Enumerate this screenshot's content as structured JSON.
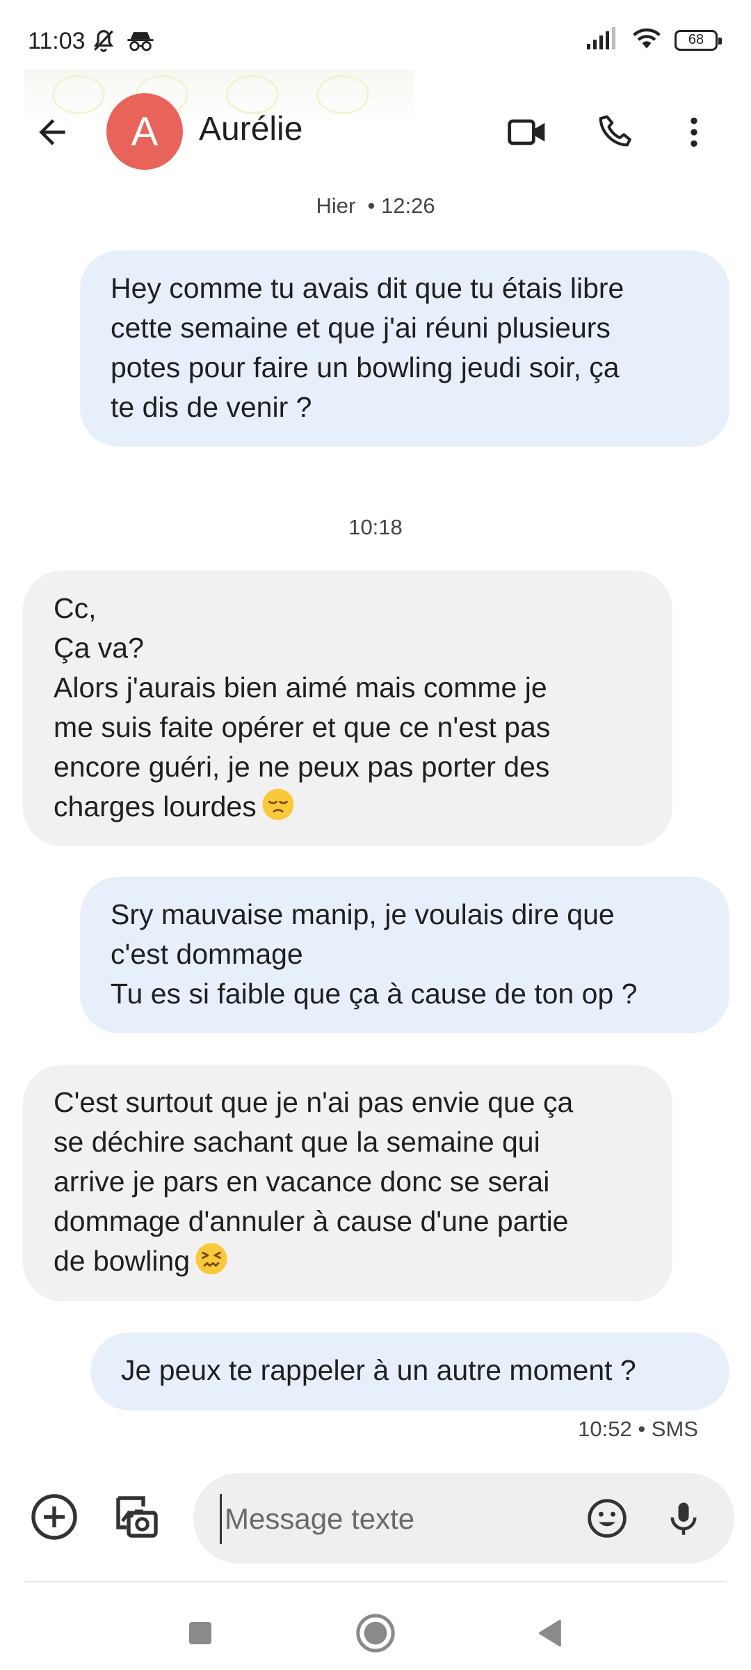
{
  "status_bar": {
    "time": "11:03",
    "battery": "68",
    "icons": [
      "mute-bell-icon",
      "incognito-icon",
      "signal-icon",
      "wifi-icon",
      "battery-icon"
    ]
  },
  "header": {
    "avatar_letter": "A",
    "avatar_color": "#e8645a",
    "contact_name": "Aurélie",
    "icons": [
      "back-arrow-icon",
      "video-call-icon",
      "phone-icon",
      "more-vert-icon"
    ]
  },
  "conversation": {
    "timestamp_1_day": "Hier",
    "timestamp_1_time": "• 12:26",
    "timestamp_2": "10:18",
    "messages": [
      {
        "direction": "outgoing",
        "lines": [
          "Hey comme tu avais dit que tu étais libre",
          "cette semaine et que j'ai réuni plusieurs",
          "potes pour faire un bowling jeudi soir, ça",
          "te dis de venir ?"
        ]
      },
      {
        "direction": "incoming",
        "lines": [
          "Cc,",
          "Ça va?",
          "Alors j'aurais bien aimé mais comme je",
          "me suis faite opérer et que ce n'est pas",
          "encore guéri, je ne peux pas porter des",
          "charges lourdes"
        ],
        "emoji": "pensive-face-emoji"
      },
      {
        "direction": "outgoing",
        "lines": [
          "Sry mauvaise manip, je voulais dire que",
          "c'est dommage",
          "Tu es si faible que ça à cause de ton op ?"
        ]
      },
      {
        "direction": "incoming",
        "lines": [
          "C'est surtout que je n'ai pas envie que ça",
          "se déchire sachant que la semaine qui",
          "arrive je pars en vacance donc se serai",
          "dommage d'annuler à cause d'une partie",
          "de bowling"
        ],
        "emoji": "confounded-face-emoji"
      },
      {
        "direction": "outgoing",
        "lines": [
          "Je peux te rappeler à un autre moment ?"
        ]
      }
    ],
    "last_meta": "10:52 • SMS"
  },
  "compose": {
    "placeholder": "Message texte",
    "icons": [
      "add-circle-icon",
      "gallery-icon",
      "emoji-icon",
      "microphone-icon"
    ]
  },
  "nav_bar": {
    "icons": [
      "recents-square-icon",
      "home-circle-icon",
      "back-triangle-icon"
    ]
  },
  "colors": {
    "outgoing_bubble": "#e7effb",
    "incoming_bubble": "#f1f1f1"
  }
}
